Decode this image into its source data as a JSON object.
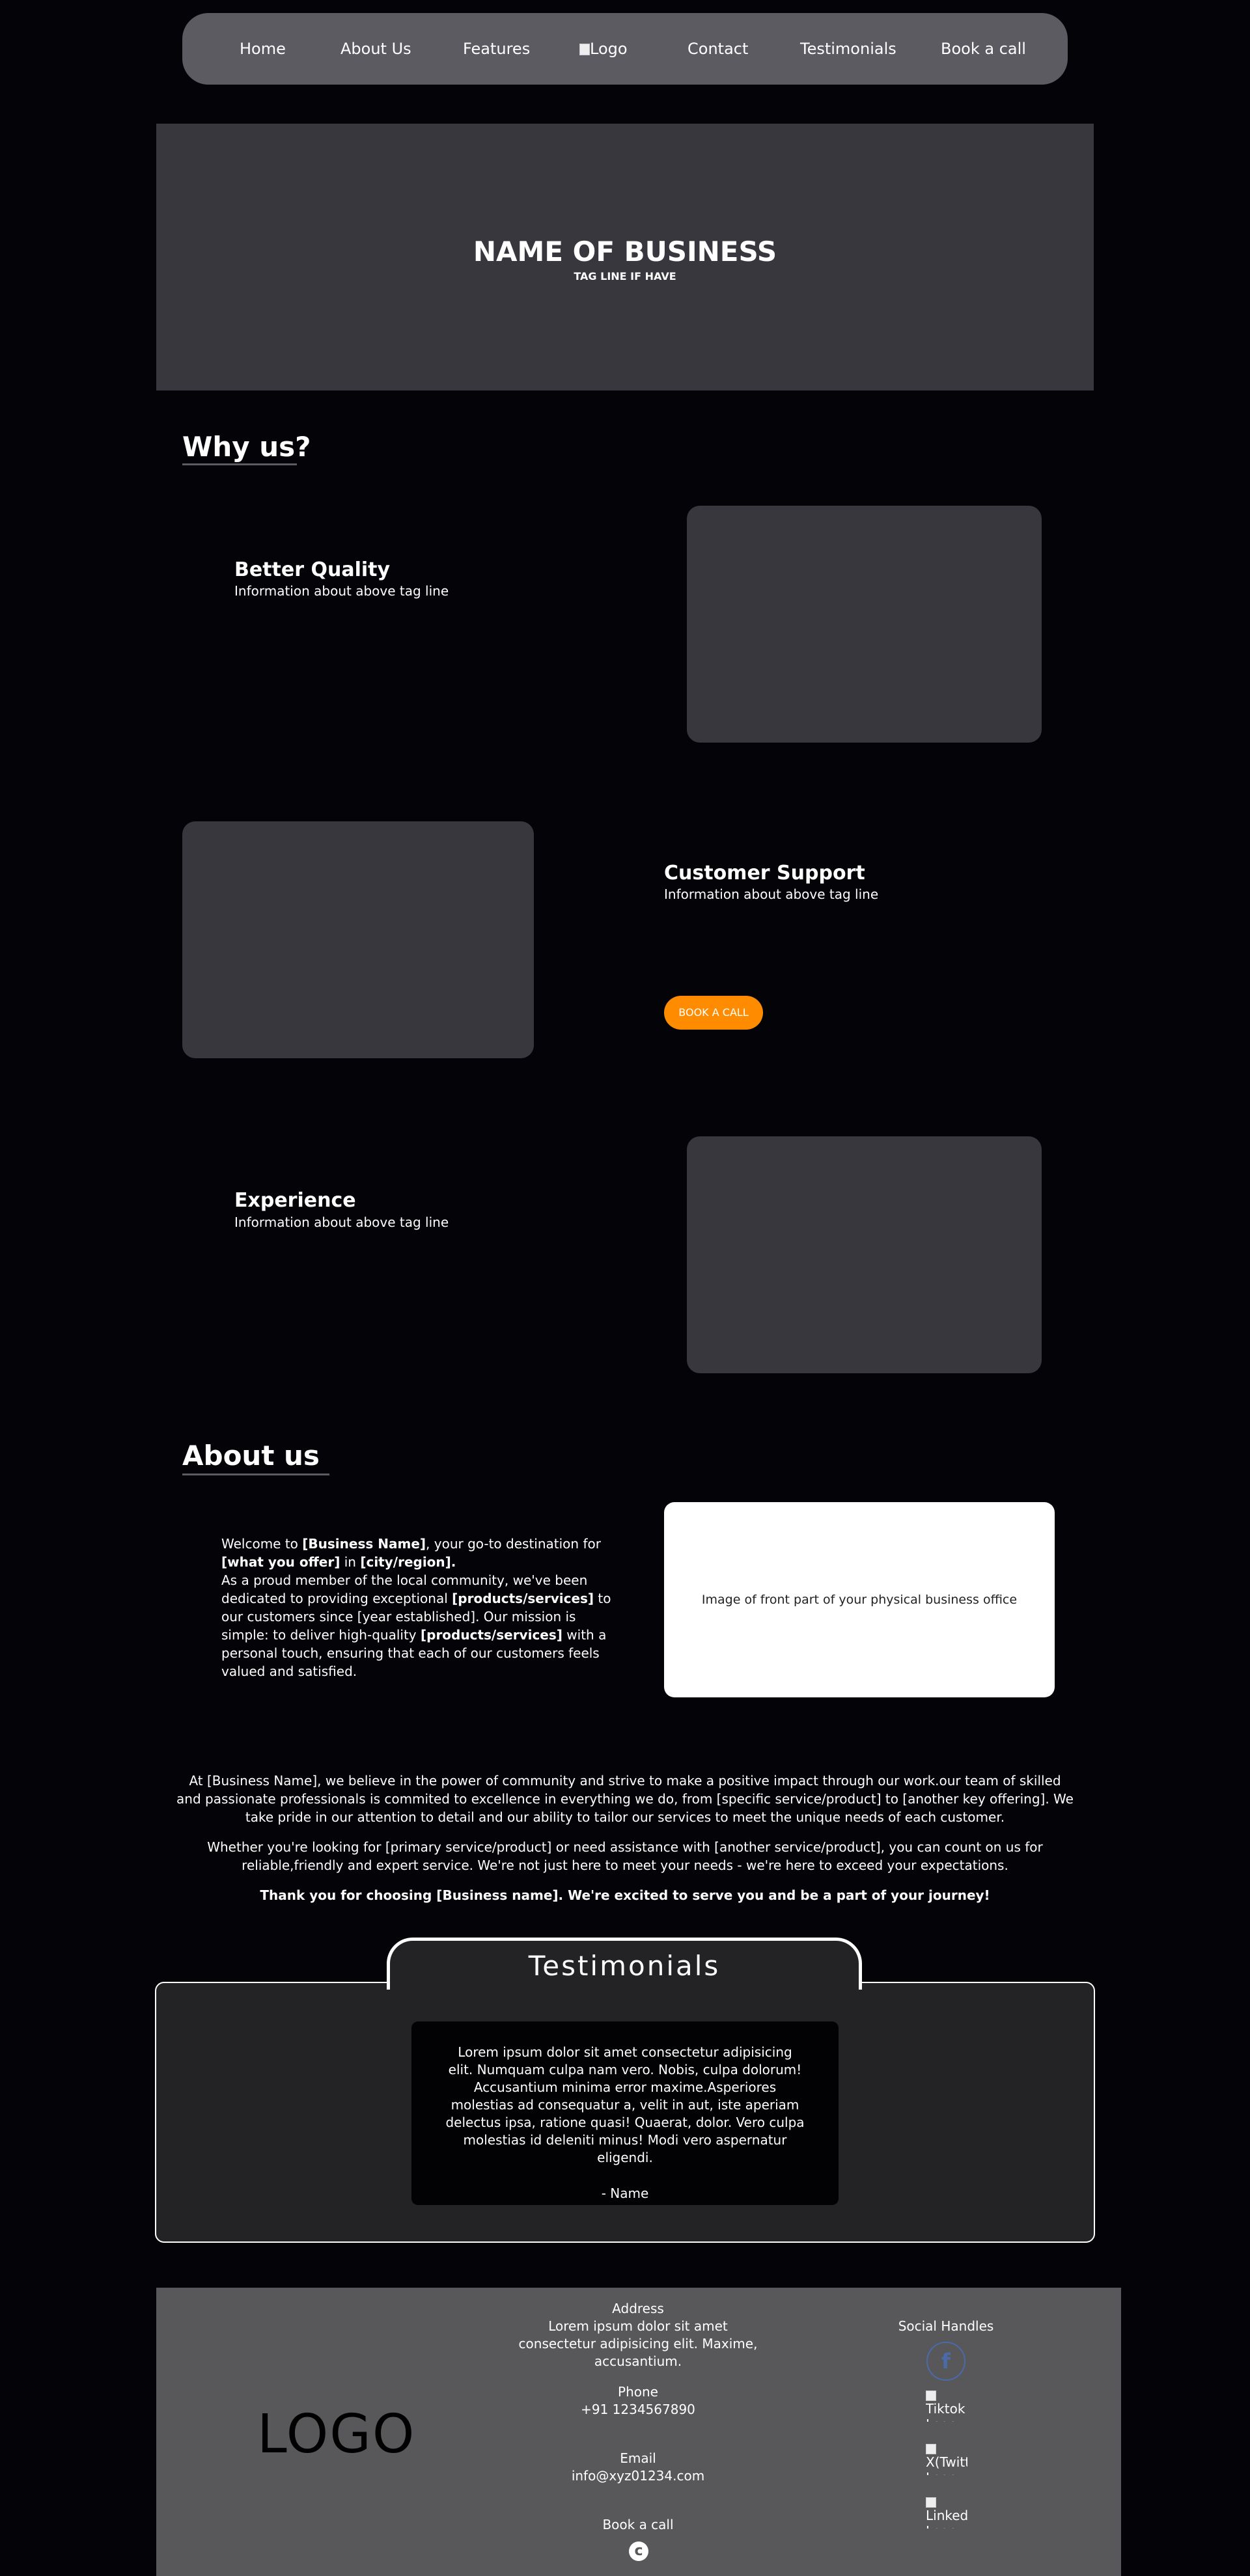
{
  "nav": {
    "items": [
      "Home",
      "About Us",
      "Features",
      "Contact",
      "Testimonials",
      "Book a call"
    ],
    "logo_alt": "Logo"
  },
  "hero": {
    "title": "NAME OF BUSINESS",
    "tagline": "TAG LINE IF HAVE"
  },
  "why_us": {
    "title": "Why us?",
    "features": [
      {
        "title": "Better Quality",
        "sub": "Information about above tag line"
      },
      {
        "title": "Customer Support",
        "sub": "Information about above tag line"
      },
      {
        "title": "Experience",
        "sub": "Information about above tag line"
      }
    ],
    "book_button": "BOOK A CALL"
  },
  "about": {
    "title": "About us",
    "p1": {
      "a": "Welcome to ",
      "b": "[Business Name]",
      "c": ", your go-to destination for ",
      "d": "[what you offer]",
      "e": " in ",
      "f": "[city/region].",
      "g": "As a proud member of the local community, we've been dedicated to providing exceptional ",
      "h": "[products/services]",
      "i": " to our customers since [year established]. Our mission is simple: to deliver high-quality ",
      "j": "[products/services]",
      "k": " with a personal touch, ensuring that each of our customers feels valued and satisfied."
    },
    "image_text": "Image of front part of your physical business office",
    "p2": "At [Business Name], we believe in the power of community and strive to make a positive impact through our work.our team of skilled and passionate professionals is commited to excellence in everything we do, from [specific service/product] to [another key offering]. We take pride in our attention to detail and our ability to tailor our services to meet the unique needs of each customer.",
    "p3": "Whether you're looking for [primary service/product] or need assistance with [another service/product], you can count on us for reliable,friendly and expert service. We're not just here to meet your needs - we're here to exceed your expectations.",
    "thanks": "Thank you for choosing [Business name]. We're excited to serve you and be a part of your journey!"
  },
  "testimonials": {
    "title": "Testimonials",
    "quote": "Lorem ipsum dolor sit amet consectetur adipisicing elit. Numquam culpa nam vero. Nobis, culpa dolorum! Accusantium minima error maxime.Asperiores molestias ad consequatur a, velit in aut, iste aperiam delectus ipsa, ratione quasi! Quaerat, dolor. Vero culpa molestias id deleniti minus! Modi vero aspernatur eligendi.",
    "name": "- Name"
  },
  "footer": {
    "logo": "LOGO",
    "address_label": "Address",
    "address_value": "Lorem ipsum dolor sit amet consectetur adipisicing elit. Maxime, accusantium.",
    "phone_label": "Phone",
    "phone_value": "+91 1234567890",
    "email_label": "Email",
    "email_value": "info@xyz01234.com",
    "book_label": "Book a call",
    "social_title": "Social Handles",
    "social": [
      "Tiktok Logo",
      "X(Twitter) Logo",
      "LinkedIn Logo"
    ]
  }
}
